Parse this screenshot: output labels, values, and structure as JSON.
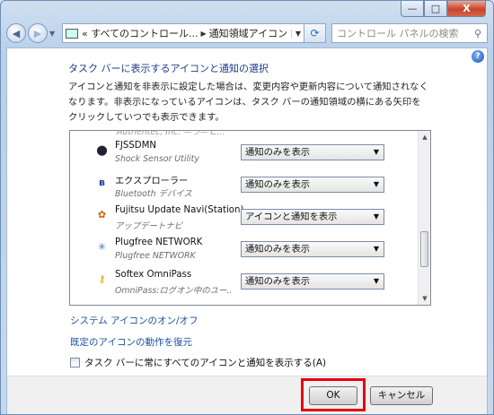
{
  "window": {
    "caption_buttons": {
      "minimize": "—",
      "maximize": "□",
      "close": "X"
    }
  },
  "nav": {
    "back_icon": "back-arrow-icon",
    "forward_icon": "forward-arrow-icon",
    "address": {
      "prefix": "«",
      "crumb1": "すべてのコントロール...",
      "crumb2": "通知領域アイコン"
    },
    "search_placeholder": "コントロール パネルの検索"
  },
  "content": {
    "title": "タスク バーに表示するアイコンと通知の選択",
    "description": "アイコンと通知を非表示に設定した場合は、変更内容や更新内容について通知されなくなります。非表示になっているアイコンは、タスク バーの通知領域の横にある矢印をクリックしていつでも表示できます。",
    "partial_row": "Authentec, Inc. —ラ—ヒ...",
    "rows": [
      {
        "name": "FJSSDMN",
        "sub": "Shock Sensor Utility",
        "value": "通知のみを表示",
        "icon": "shock-sensor-icon"
      },
      {
        "name": "エクスプローラー",
        "sub": "Bluetooth デバイス",
        "value": "通知のみを表示",
        "icon": "bluetooth-icon"
      },
      {
        "name": "Fujitsu Update Navi(Station)",
        "sub": "アップデートナビ",
        "value": "アイコンと通知を表示",
        "icon": "update-navi-icon"
      },
      {
        "name": "Plugfree NETWORK",
        "sub": "Plugfree NETWORK",
        "value": "通知のみを表示",
        "icon": "network-icon"
      },
      {
        "name": "Softex OmniPass",
        "sub": "OmniPass:ログオン中のユー...",
        "value": "通知のみを表示",
        "icon": "key-icon"
      }
    ],
    "link_system_icons": "システム アイコンのオン/オフ",
    "link_restore": "既定のアイコンの動作を復元",
    "checkbox_label": "タスク バーに常にすべてのアイコンと通知を表示する(A)",
    "checkbox_checked": false
  },
  "footer": {
    "ok": "OK",
    "cancel": "キャンセル",
    "highlight_color": "#e60012"
  }
}
